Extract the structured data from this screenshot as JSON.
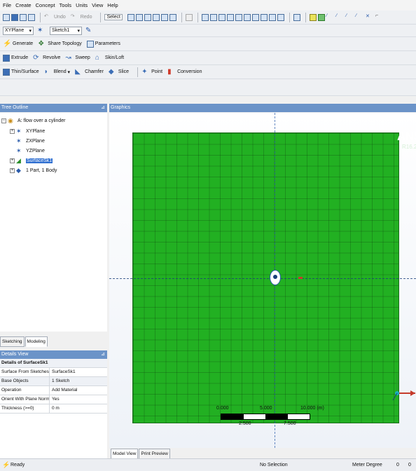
{
  "menu": [
    "File",
    "Create",
    "Concept",
    "Tools",
    "Units",
    "View",
    "Help"
  ],
  "toolbar1": {
    "undo": "Undo",
    "redo": "Redo",
    "select": "Select"
  },
  "toolbar2": {
    "plane": "XYPlane",
    "sketch": "Sketch1"
  },
  "toolbar3": {
    "generate": "Generate",
    "share_topology": "Share Topology",
    "parameters": "Parameters"
  },
  "toolbar4": {
    "extrude": "Extrude",
    "revolve": "Revolve",
    "sweep": "Sweep",
    "skin_loft": "Skin/Loft"
  },
  "toolbar5": {
    "thin_surface": "Thin/Surface",
    "blend": "Blend",
    "chamfer": "Chamfer",
    "slice": "Slice",
    "point": "Point",
    "conversion": "Conversion"
  },
  "tree_outline": {
    "header": "Tree Outline",
    "root": "A: flow over a cylinder",
    "items": [
      "XYPlane",
      "ZXPlane",
      "YZPlane",
      "SurfaceSk1",
      "1 Part, 1 Body"
    ]
  },
  "bottom_tabs": {
    "sketching": "Sketching",
    "modeling": "Modeling"
  },
  "details": {
    "header": "Details View",
    "title": "Details of SurfaceSk1",
    "rows": [
      {
        "label": "Surface From Sketches",
        "value": "SurfaceSk1"
      },
      {
        "label": "Base Objects",
        "value": "1 Sketch"
      },
      {
        "label": "Operation",
        "value": "Add Material"
      },
      {
        "label": "Orient With Plane Normal?",
        "value": "Yes"
      },
      {
        "label": "Thickness (>=0)",
        "value": "0 m"
      }
    ]
  },
  "graphics": {
    "header": "Graphics",
    "logo": "ANSYS",
    "version": "R16.2",
    "scale_top": [
      "0.000",
      "5.000",
      "10.000 (m)"
    ],
    "scale_bottom": [
      "2.500",
      "7.500"
    ],
    "tabs": {
      "model_view": "Model View",
      "print_preview": "Print Preview"
    },
    "surface_color": "#22b022"
  },
  "status": {
    "ready": "Ready",
    "selection": "No Selection",
    "units": "Meter  Degree",
    "val1": "0",
    "val2": "0"
  }
}
